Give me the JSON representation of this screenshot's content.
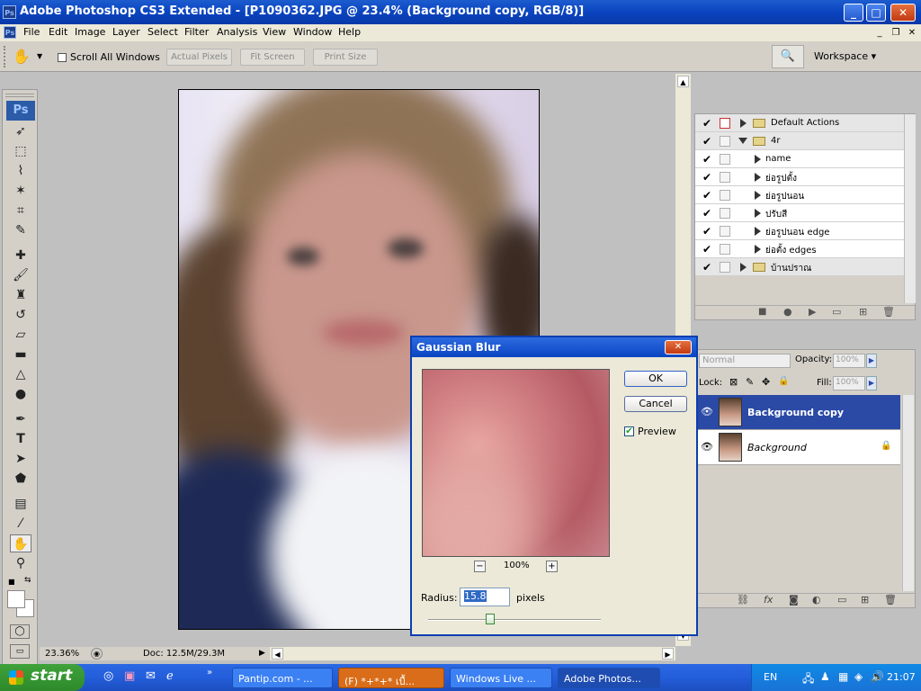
{
  "window": {
    "title": "Adobe Photoshop CS3 Extended - [P1090362.JPG @ 23.4% (Background copy, RGB/8)]",
    "app_icon": "Ps",
    "buttons": [
      "_",
      "□",
      "✕"
    ]
  },
  "menubar": {
    "items": [
      "File",
      "Edit",
      "Image",
      "Layer",
      "Select",
      "Filter",
      "Analysis",
      "View",
      "Window",
      "Help"
    ]
  },
  "options": {
    "scroll_all": "Scroll All Windows",
    "actual_pixels": "Actual Pixels",
    "fit_screen": "Fit Screen",
    "print_size": "Print Size",
    "workspace": "Workspace ▾"
  },
  "toolbox": {
    "logo": "Ps"
  },
  "status": {
    "zoom": "23.36%",
    "doc": "Doc: 12.5M/29.3M"
  },
  "actions": {
    "rows": [
      {
        "label": "Default Actions",
        "type": "set",
        "expanded": false
      },
      {
        "label": "4r",
        "type": "set",
        "expanded": true
      },
      {
        "label": "name",
        "type": "action"
      },
      {
        "label": "ย่อรูปตั้ง",
        "type": "action"
      },
      {
        "label": "ย่อรูปนอน",
        "type": "action"
      },
      {
        "label": "ปรับสี",
        "type": "action"
      },
      {
        "label": "ย่อรูปนอน edge",
        "type": "action"
      },
      {
        "label": "ย่อตั้ง edges",
        "type": "action"
      },
      {
        "label": "บ้านปราณ",
        "type": "set",
        "expanded": false
      }
    ]
  },
  "layers": {
    "blend": "Normal",
    "opacity_label": "Opacity:",
    "opacity": "100%",
    "lock_label": "Lock:",
    "fill_label": "Fill:",
    "fill": "100%",
    "items": [
      {
        "name": "Background copy",
        "selected": true
      },
      {
        "name": "Background",
        "selected": false,
        "locked": true
      }
    ]
  },
  "gaussian": {
    "title": "Gaussian Blur",
    "ok": "OK",
    "cancel": "Cancel",
    "preview": "Preview",
    "zoom": "100%",
    "radius_label": "Radius:",
    "radius": "15.8",
    "unit": "pixels",
    "slider_level": 0.36
  },
  "taskbar": {
    "start": "start",
    "tasks": [
      "Pantip.com - ...",
      "(F) *+*+* เบื้...",
      "Windows Live ...",
      "Adobe Photos..."
    ],
    "lang": "EN",
    "clock": "21:07"
  },
  "colors": {
    "title_blue": "#0a44c0",
    "selection": "#2b4aa6",
    "xp_green": "#3fa23a",
    "xp_blue": "#245edb"
  }
}
